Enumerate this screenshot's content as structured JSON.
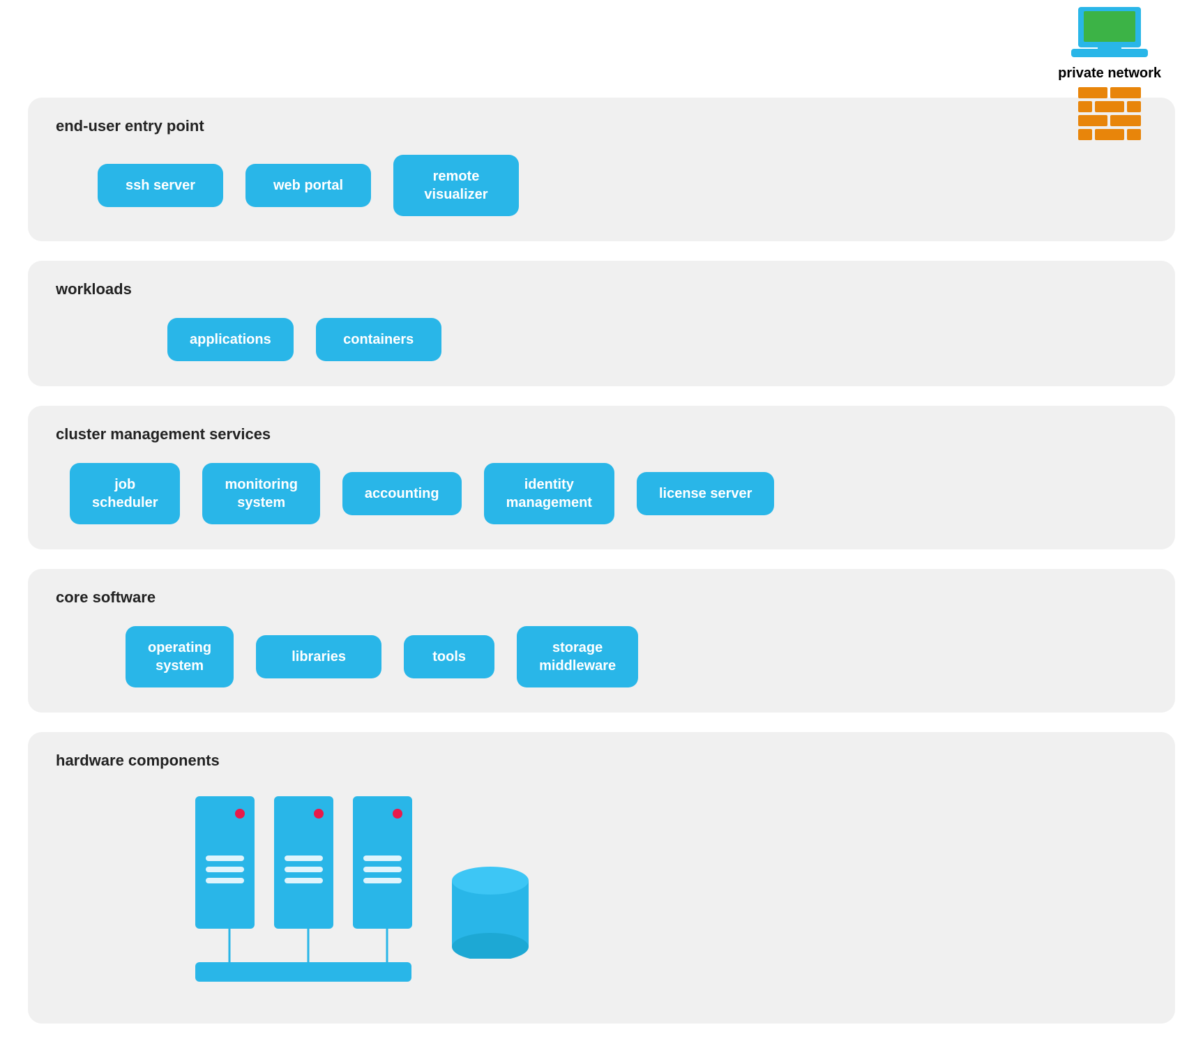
{
  "private_network": {
    "label": "private network"
  },
  "sections": {
    "entry_point": {
      "title": "end-user entry point",
      "chips": [
        {
          "id": "ssh-server",
          "label": "ssh server"
        },
        {
          "id": "web-portal",
          "label": "web portal"
        },
        {
          "id": "remote-visualizer",
          "label": "remote\nvisualizer"
        }
      ]
    },
    "workloads": {
      "title": "workloads",
      "chips": [
        {
          "id": "applications",
          "label": "applications"
        },
        {
          "id": "containers",
          "label": "containers"
        }
      ]
    },
    "cluster_mgmt": {
      "title": "cluster management services",
      "chips": [
        {
          "id": "job-scheduler",
          "label": "job\nscheduler"
        },
        {
          "id": "monitoring-system",
          "label": "monitoring\nsystem"
        },
        {
          "id": "accounting",
          "label": "accounting"
        },
        {
          "id": "identity-management",
          "label": "identity\nmanagement"
        },
        {
          "id": "license-server",
          "label": "license server"
        }
      ]
    },
    "core_software": {
      "title": "core software",
      "chips": [
        {
          "id": "operating-system",
          "label": "operating\nsystem"
        },
        {
          "id": "libraries",
          "label": "libraries"
        },
        {
          "id": "tools",
          "label": "tools"
        },
        {
          "id": "storage-middleware",
          "label": "storage\nmiddleware"
        }
      ]
    },
    "hardware": {
      "title": "hardware components"
    }
  }
}
